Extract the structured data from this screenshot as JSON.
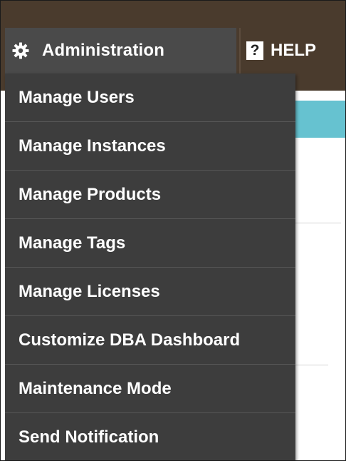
{
  "nav": {
    "admin_label": "Administration",
    "admin_icon": "gear-icon",
    "help_icon_glyph": "?",
    "help_label": "HELP"
  },
  "menu": {
    "items": [
      {
        "label": "Manage Users"
      },
      {
        "label": "Manage Instances"
      },
      {
        "label": "Manage Products"
      },
      {
        "label": "Manage Tags"
      },
      {
        "label": "Manage Licenses"
      },
      {
        "label": "Customize DBA Dashboard"
      },
      {
        "label": "Maintenance Mode"
      },
      {
        "label": "Send Notification"
      }
    ]
  },
  "colors": {
    "topbar": "#4a3b2d",
    "tab_active": "#4a4a4a",
    "menu_bg": "#3d3d3d",
    "accent_band": "#66c2d0",
    "text": "#ffffff"
  }
}
